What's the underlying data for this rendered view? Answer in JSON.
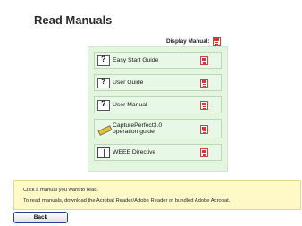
{
  "title": "Read Manuals",
  "display_manual_label": "Display Manual:",
  "manuals": [
    {
      "label": "Easy Start Guide",
      "icon": "help-doc-icon"
    },
    {
      "label": "User Guide",
      "icon": "help-doc-icon"
    },
    {
      "label": "User Manual",
      "icon": "help-doc-icon"
    },
    {
      "label_line1": "CapturePerfect3.0",
      "label_line2": "operation guide",
      "icon": "pencil-icon"
    },
    {
      "label": "WEEE Directive",
      "icon": "book-icon"
    }
  ],
  "info": {
    "line1": "Click a manual you want to read.",
    "line2": "To read manuals, download the Acrobat Reader/Adobe Reader or bundled Adobe Acrobat."
  },
  "back_label": "Back",
  "colors": {
    "panel_bg": "#e3f4df",
    "row_bg": "#e7f8e6",
    "info_bg": "#fff9c8",
    "pdf_red": "#d33",
    "back_border": "#2b3e8f"
  }
}
